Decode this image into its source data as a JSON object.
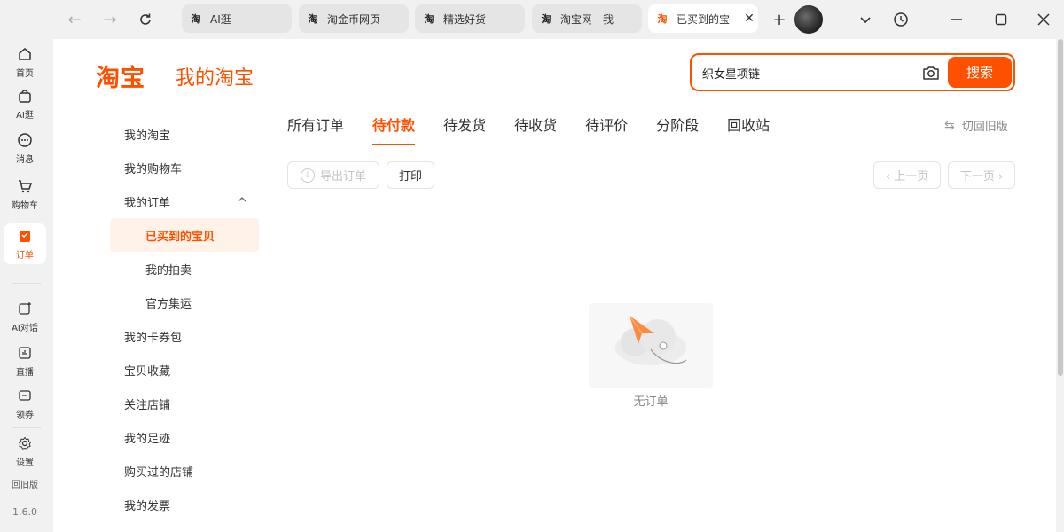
{
  "browser": {
    "tabs": [
      {
        "logo": "淘",
        "label": "AI逛"
      },
      {
        "logo": "淘",
        "label": "淘金币网页"
      },
      {
        "logo": "淘",
        "label": "精选好货"
      },
      {
        "logo": "淘",
        "label": "淘宝网 - 我"
      },
      {
        "logo": "淘",
        "label": "已买到的宝",
        "active": true
      }
    ],
    "close_tab_icon": "close-icon",
    "new_tab_icon": "plus-icon"
  },
  "rail": {
    "items": [
      {
        "label": "首页",
        "icon": "home-icon"
      },
      {
        "label": "AI逛",
        "icon": "bag-icon"
      },
      {
        "label": "消息",
        "icon": "message-icon"
      },
      {
        "label": "购物车",
        "icon": "cart-icon"
      },
      {
        "label": "订单",
        "icon": "order-icon",
        "active": true
      },
      {
        "label": "AI对话",
        "icon": "ai-chat-icon"
      },
      {
        "label": "直播",
        "icon": "live-icon"
      },
      {
        "label": "领券",
        "icon": "coupon-icon"
      },
      {
        "label": "设置",
        "icon": "settings-icon"
      }
    ],
    "back_old": "回旧版",
    "version": "1.6.0"
  },
  "header": {
    "logo": "淘宝",
    "title": "我的淘宝",
    "search_value": "织女星项链",
    "search_button": "搜索"
  },
  "sidenav": {
    "items": [
      {
        "label": "我的淘宝"
      },
      {
        "label": "我的购物车"
      },
      {
        "label": "我的订单",
        "expanded": true
      },
      {
        "label": "已买到的宝贝",
        "sub": true,
        "active": true
      },
      {
        "label": "我的拍卖",
        "sub": true
      },
      {
        "label": "官方集运",
        "sub": true
      },
      {
        "label": "我的卡券包"
      },
      {
        "label": "宝贝收藏"
      },
      {
        "label": "关注店铺"
      },
      {
        "label": "我的足迹"
      },
      {
        "label": "购买过的店铺"
      },
      {
        "label": "我的发票"
      }
    ]
  },
  "order_tabs": [
    "所有订单",
    "待付款",
    "待发货",
    "待收货",
    "待评价",
    "分阶段",
    "回收站"
  ],
  "active_order_tab": "待付款",
  "switch_old": "切回旧版",
  "actions": {
    "export": "导出订单",
    "print": "打印",
    "prev": "‹ 上一页",
    "next": "下一页 ›"
  },
  "empty": {
    "text": "无订单"
  },
  "colors": {
    "accent": "#ff5000",
    "accent_light": "#fff2e8"
  }
}
